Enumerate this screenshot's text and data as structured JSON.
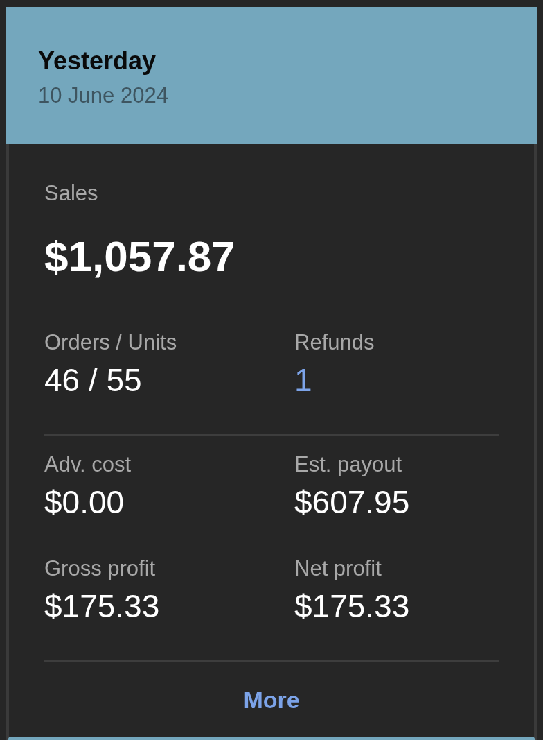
{
  "header": {
    "title": "Yesterday",
    "date": "10 June 2024"
  },
  "sales": {
    "label": "Sales",
    "value": "$1,057.87"
  },
  "sections": [
    {
      "metrics": [
        {
          "label": "Orders / Units",
          "value": "46 / 55",
          "kind": "text"
        },
        {
          "label": "Refunds",
          "value": "1",
          "kind": "link"
        }
      ]
    },
    {
      "metrics": [
        {
          "label": "Adv. cost",
          "value": "$0.00",
          "kind": "text"
        },
        {
          "label": "Est. payout",
          "value": "$607.95",
          "kind": "text"
        },
        {
          "label": "Gross profit",
          "value": "$175.33",
          "kind": "text"
        },
        {
          "label": "Net profit",
          "value": "$175.33",
          "kind": "text"
        }
      ]
    }
  ],
  "more_link": "More"
}
